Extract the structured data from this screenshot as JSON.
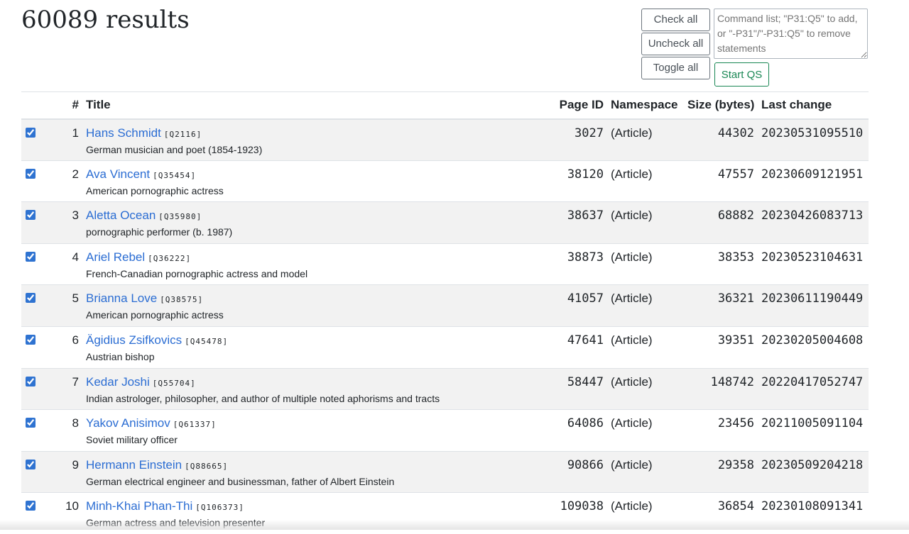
{
  "heading": "60089 results",
  "buttons": {
    "check_all": "Check all",
    "uncheck_all": "Uncheck all",
    "toggle_all": "Toggle all",
    "start_qs": "Start QS"
  },
  "command_list": {
    "placeholder": "Command list; \"P31:Q5\" to add, or \"-P31\"/\"-P31:Q5\" to remove statements",
    "value": ""
  },
  "table": {
    "headers": {
      "num": "#",
      "title": "Title",
      "page_id": "Page ID",
      "namespace": "Namespace",
      "size": "Size (bytes)",
      "last_change": "Last change"
    },
    "rows": [
      {
        "num": "1",
        "title": "Hans Schmidt",
        "qid": "[Q2116]",
        "description": "German musician and poet (1854-1923)",
        "page_id": "3027",
        "namespace": "(Article)",
        "size": "44302",
        "last_change": "20230531095510",
        "checked": true
      },
      {
        "num": "2",
        "title": "Ava Vincent",
        "qid": "[Q35454]",
        "description": "American pornographic actress",
        "page_id": "38120",
        "namespace": "(Article)",
        "size": "47557",
        "last_change": "20230609121951",
        "checked": true
      },
      {
        "num": "3",
        "title": "Aletta Ocean",
        "qid": "[Q35980]",
        "description": "pornographic performer (b. 1987)",
        "page_id": "38637",
        "namespace": "(Article)",
        "size": "68882",
        "last_change": "20230426083713",
        "checked": true
      },
      {
        "num": "4",
        "title": "Ariel Rebel",
        "qid": "[Q36222]",
        "description": "French-Canadian pornographic actress and model",
        "page_id": "38873",
        "namespace": "(Article)",
        "size": "38353",
        "last_change": "20230523104631",
        "checked": true
      },
      {
        "num": "5",
        "title": "Brianna Love",
        "qid": "[Q38575]",
        "description": "American pornographic actress",
        "page_id": "41057",
        "namespace": "(Article)",
        "size": "36321",
        "last_change": "20230611190449",
        "checked": true
      },
      {
        "num": "6",
        "title": "Ägidius Zsifkovics",
        "qid": "[Q45478]",
        "description": "Austrian bishop",
        "page_id": "47641",
        "namespace": "(Article)",
        "size": "39351",
        "last_change": "20230205004608",
        "checked": true
      },
      {
        "num": "7",
        "title": "Kedar Joshi",
        "qid": "[Q55704]",
        "description": "Indian astrologer, philosopher, and author of multiple noted aphorisms and tracts",
        "page_id": "58447",
        "namespace": "(Article)",
        "size": "148742",
        "last_change": "20220417052747",
        "checked": true
      },
      {
        "num": "8",
        "title": "Yakov Anisimov",
        "qid": "[Q61337]",
        "description": "Soviet military officer",
        "page_id": "64086",
        "namespace": "(Article)",
        "size": "23456",
        "last_change": "20211005091104",
        "checked": true
      },
      {
        "num": "9",
        "title": "Hermann Einstein",
        "qid": "[Q88665]",
        "description": "German electrical engineer and businessman, father of Albert Einstein",
        "page_id": "90866",
        "namespace": "(Article)",
        "size": "29358",
        "last_change": "20230509204218",
        "checked": true
      },
      {
        "num": "10",
        "title": "Minh-Khai Phan-Thi",
        "qid": "[Q106373]",
        "description": "German actress and television presenter",
        "page_id": "109038",
        "namespace": "(Article)",
        "size": "36854",
        "last_change": "20230108091341",
        "checked": true
      }
    ]
  },
  "colors": {
    "link": "#2b6dd3",
    "stripe": "#f2f2f2",
    "start_qs": "#198754",
    "checkbox": "#2f73d1"
  }
}
